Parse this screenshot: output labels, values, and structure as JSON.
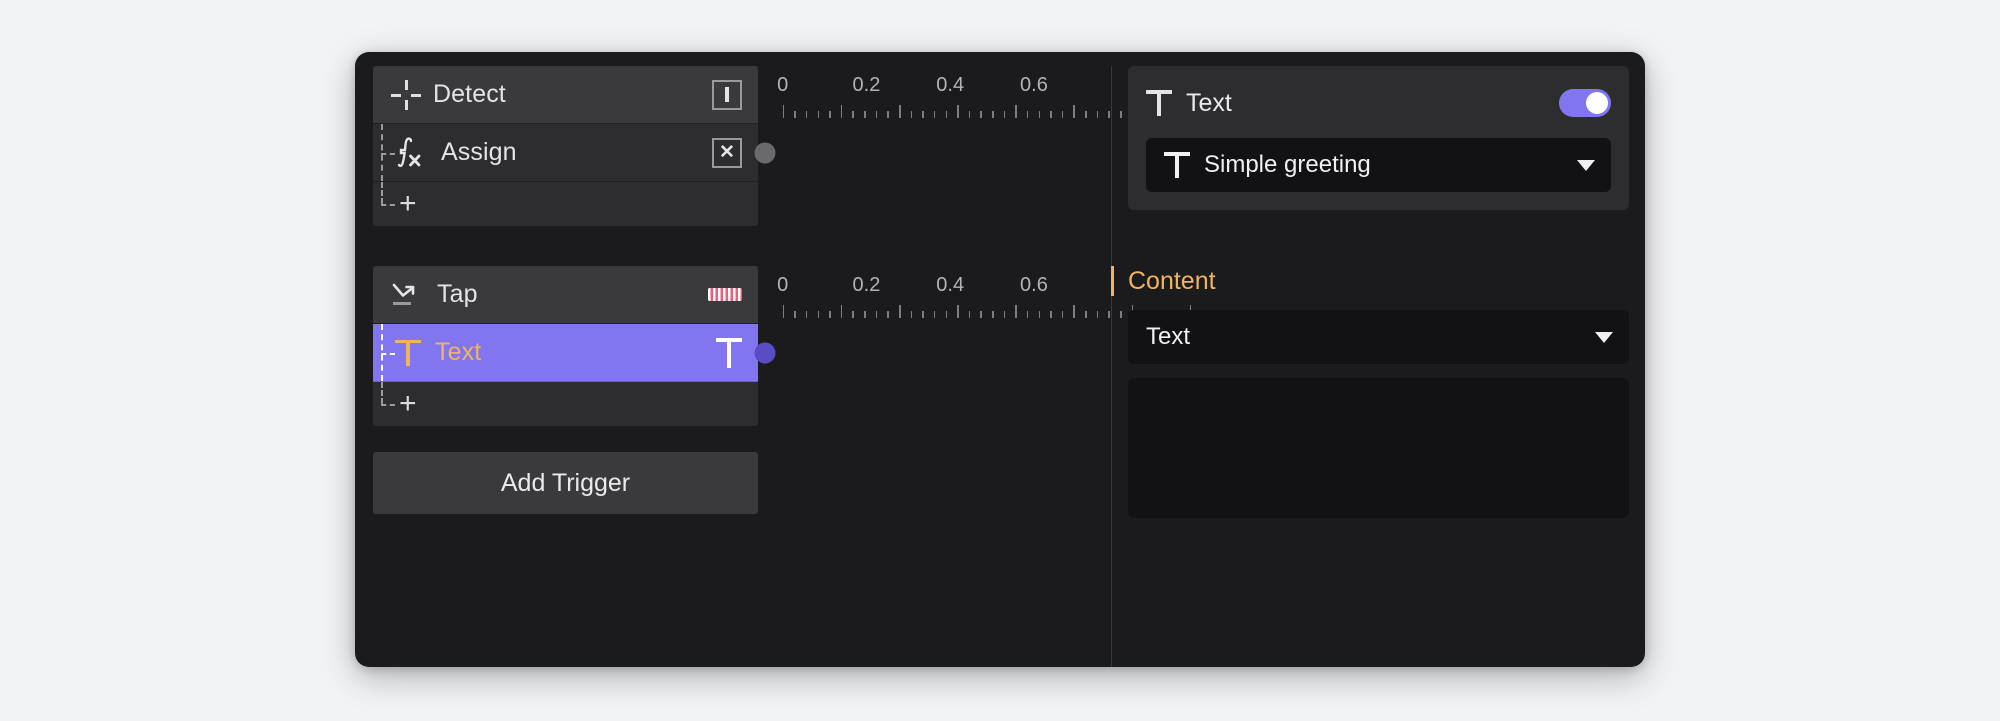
{
  "window": {
    "background": "#1b1b1d",
    "accent_purple": "#8276f0",
    "accent_orange": "#f0b45f",
    "accent_pink": "#e8607e"
  },
  "node_tree": {
    "groups": [
      {
        "header": {
          "label": "Detect",
          "icon": "crosshair-icon",
          "right_icon": "boxed-bar-icon"
        },
        "children": [
          {
            "label": "Assign",
            "icon": "fx-icon",
            "right_icon": "boxed-x-icon",
            "selected": false
          }
        ],
        "add_label": "+"
      },
      {
        "header": {
          "label": "Tap",
          "icon": "tap-arrow-icon",
          "right_icon": "stripe-icon"
        },
        "children": [
          {
            "label": "Text",
            "icon": "text-T-icon",
            "right_icon": "text-T-icon",
            "selected": true
          }
        ],
        "add_label": "+"
      }
    ],
    "add_trigger_label": "Add Trigger"
  },
  "timeline": {
    "rulers": [
      {
        "labels": [
          "0",
          "0.2",
          "0.4",
          "0.6"
        ],
        "positions_pct": [
          2,
          27,
          52,
          77
        ],
        "keyframe": {
          "position_pct": 2,
          "color": "grey"
        }
      },
      {
        "labels": [
          "0",
          "0.2",
          "0.4",
          "0.6"
        ],
        "positions_pct": [
          2,
          27,
          52,
          77
        ],
        "keyframe": {
          "position_pct": 2,
          "color": "purple"
        }
      }
    ],
    "tick_count": 36,
    "major_every": 5
  },
  "inspector": {
    "text_card": {
      "title": "Text",
      "icon": "text-T-icon",
      "toggle_on": true,
      "select": {
        "icon": "text-T-icon",
        "value": "Simple greeting",
        "caret": "chevron-down-icon"
      }
    },
    "content_section": {
      "label": "Content",
      "select": {
        "value": "Text",
        "caret": "chevron-down-icon"
      },
      "editor_value": ""
    }
  }
}
